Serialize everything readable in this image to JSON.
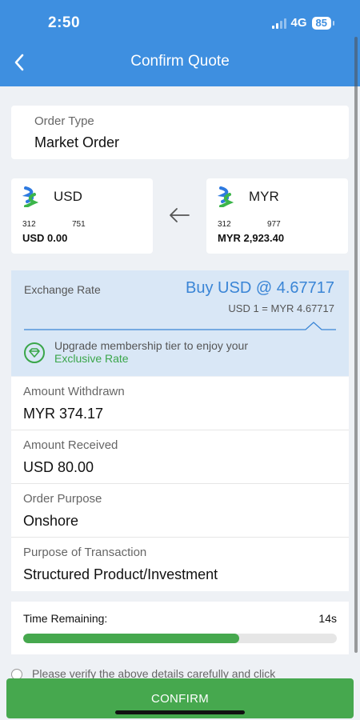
{
  "status_bar": {
    "time": "2:50",
    "network": "4G",
    "battery": "85"
  },
  "header": {
    "title": "Confirm Quote"
  },
  "order_type": {
    "label": "Order Type",
    "value": "Market Order"
  },
  "currency_from": {
    "code": "USD",
    "small_left": "312",
    "small_right": "751",
    "amount": "USD 0.00"
  },
  "currency_to": {
    "code": "MYR",
    "small_left": "312",
    "small_right": "977",
    "amount": "MYR 2,923.40"
  },
  "exchange": {
    "label": "Exchange Rate",
    "main": "Buy USD @ 4.67717",
    "sub": "USD 1 = MYR 4.67717",
    "upgrade_text": "Upgrade membership tier to enjoy your",
    "upgrade_link": "Exclusive Rate"
  },
  "details": [
    {
      "label": "Amount Withdrawn",
      "value": "MYR 374.17"
    },
    {
      "label": "Amount Received",
      "value": "USD 80.00"
    },
    {
      "label": "Order Purpose",
      "value": "Onshore"
    },
    {
      "label": "Purpose of Transaction",
      "value": "Structured Product/Investment"
    }
  ],
  "timer": {
    "label": "Time Remaining:",
    "value": "14s",
    "progress_fraction": 0.69
  },
  "disclaimer": {
    "text": "Please verify the above details carefully and click"
  },
  "confirm": {
    "label": "CONFIRM"
  },
  "colors": {
    "header": "#3e8fe0",
    "accent_blue": "#3a85d6",
    "confirm_green": "#46a84e",
    "link_green": "#3aa64a",
    "rate_bg": "#d9e7f6"
  },
  "icons": {
    "back": "chevron-left-icon",
    "swap": "arrow-left-icon",
    "bank_logo": "bank-logo-icon",
    "gem": "diamond-icon"
  }
}
